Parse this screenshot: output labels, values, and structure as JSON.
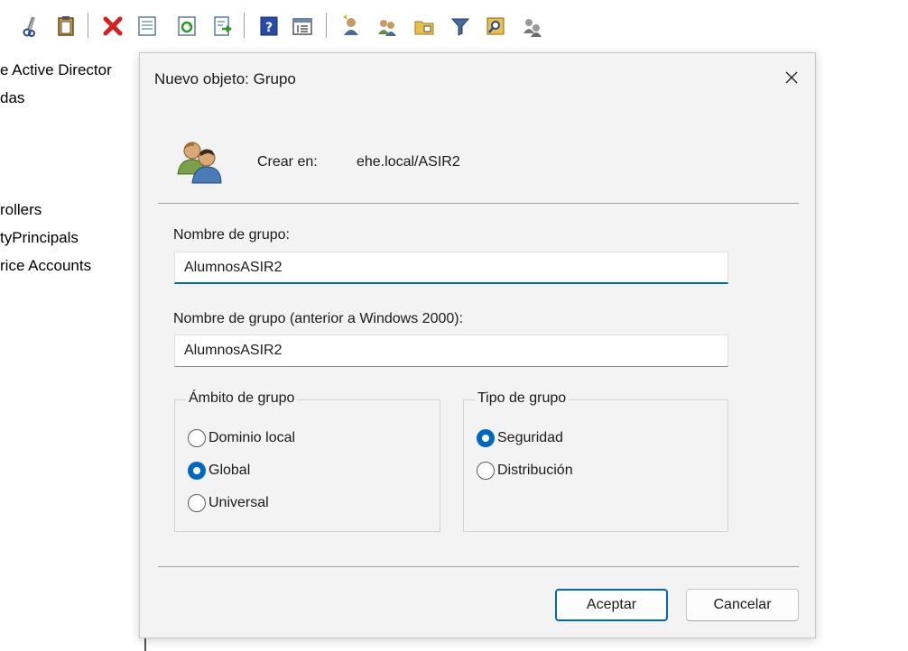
{
  "toolbar": {
    "icons": [
      "cut-icon",
      "paste-icon",
      "delete-icon",
      "properties-icon",
      "refresh-icon",
      "export-list-icon",
      "help-icon",
      "show-console-tree-icon",
      "new-user-icon",
      "new-group-icon",
      "new-ou-icon",
      "filter-icon",
      "find-icon",
      "add-to-group-icon"
    ]
  },
  "tree": {
    "items": [
      "e Active Director",
      "das",
      "rollers",
      "tyPrincipals",
      "rice Accounts"
    ]
  },
  "dialog": {
    "title": "Nuevo objeto: Grupo",
    "crear_en_label": "Crear en:",
    "crear_en_path": "ehe.local/ASIR2",
    "group_name_label": "Nombre de grupo:",
    "group_name_value": "AlumnosASIR2",
    "group_name_pre2000_label": "Nombre de grupo (anterior a Windows 2000):",
    "group_name_pre2000_value": "AlumnosASIR2",
    "scope": {
      "title": "Ámbito de grupo",
      "options": [
        "Dominio local",
        "Global",
        "Universal"
      ],
      "selected": "Global"
    },
    "type": {
      "title": "Tipo de grupo",
      "options": [
        "Seguridad",
        "Distribución"
      ],
      "selected": "Seguridad"
    },
    "ok_label": "Aceptar",
    "cancel_label": "Cancelar"
  },
  "colors": {
    "accent": "#0067c0",
    "dialog_bg": "#f3f3f3",
    "delete_red": "#d42020"
  }
}
